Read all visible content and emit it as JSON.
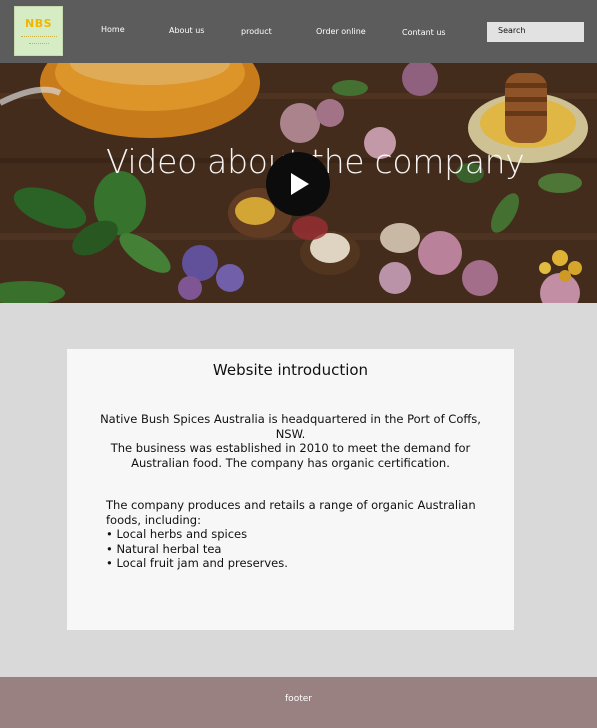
{
  "header": {
    "logo_text": "NBS",
    "nav": [
      "Home",
      "About us",
      "product",
      "Order online",
      "Contant us"
    ],
    "search_label": "Search"
  },
  "hero": {
    "title": "Video about the company",
    "play_icon": "play-icon"
  },
  "intro": {
    "title": "Website introduction",
    "paragraph1": "Native Bush Spices Australia is headquartered in the Port of Coffs, NSW.",
    "paragraph2": "The business was established in 2010 to meet the demand for Australian food. The company has organic certification.",
    "products_lead": "The company produces and retails a range of organic Australian foods, including:",
    "products": [
      "Local herbs and spices",
      "Natural herbal tea",
      "Local fruit jam and preserves."
    ]
  },
  "footer": {
    "text": "footer"
  }
}
